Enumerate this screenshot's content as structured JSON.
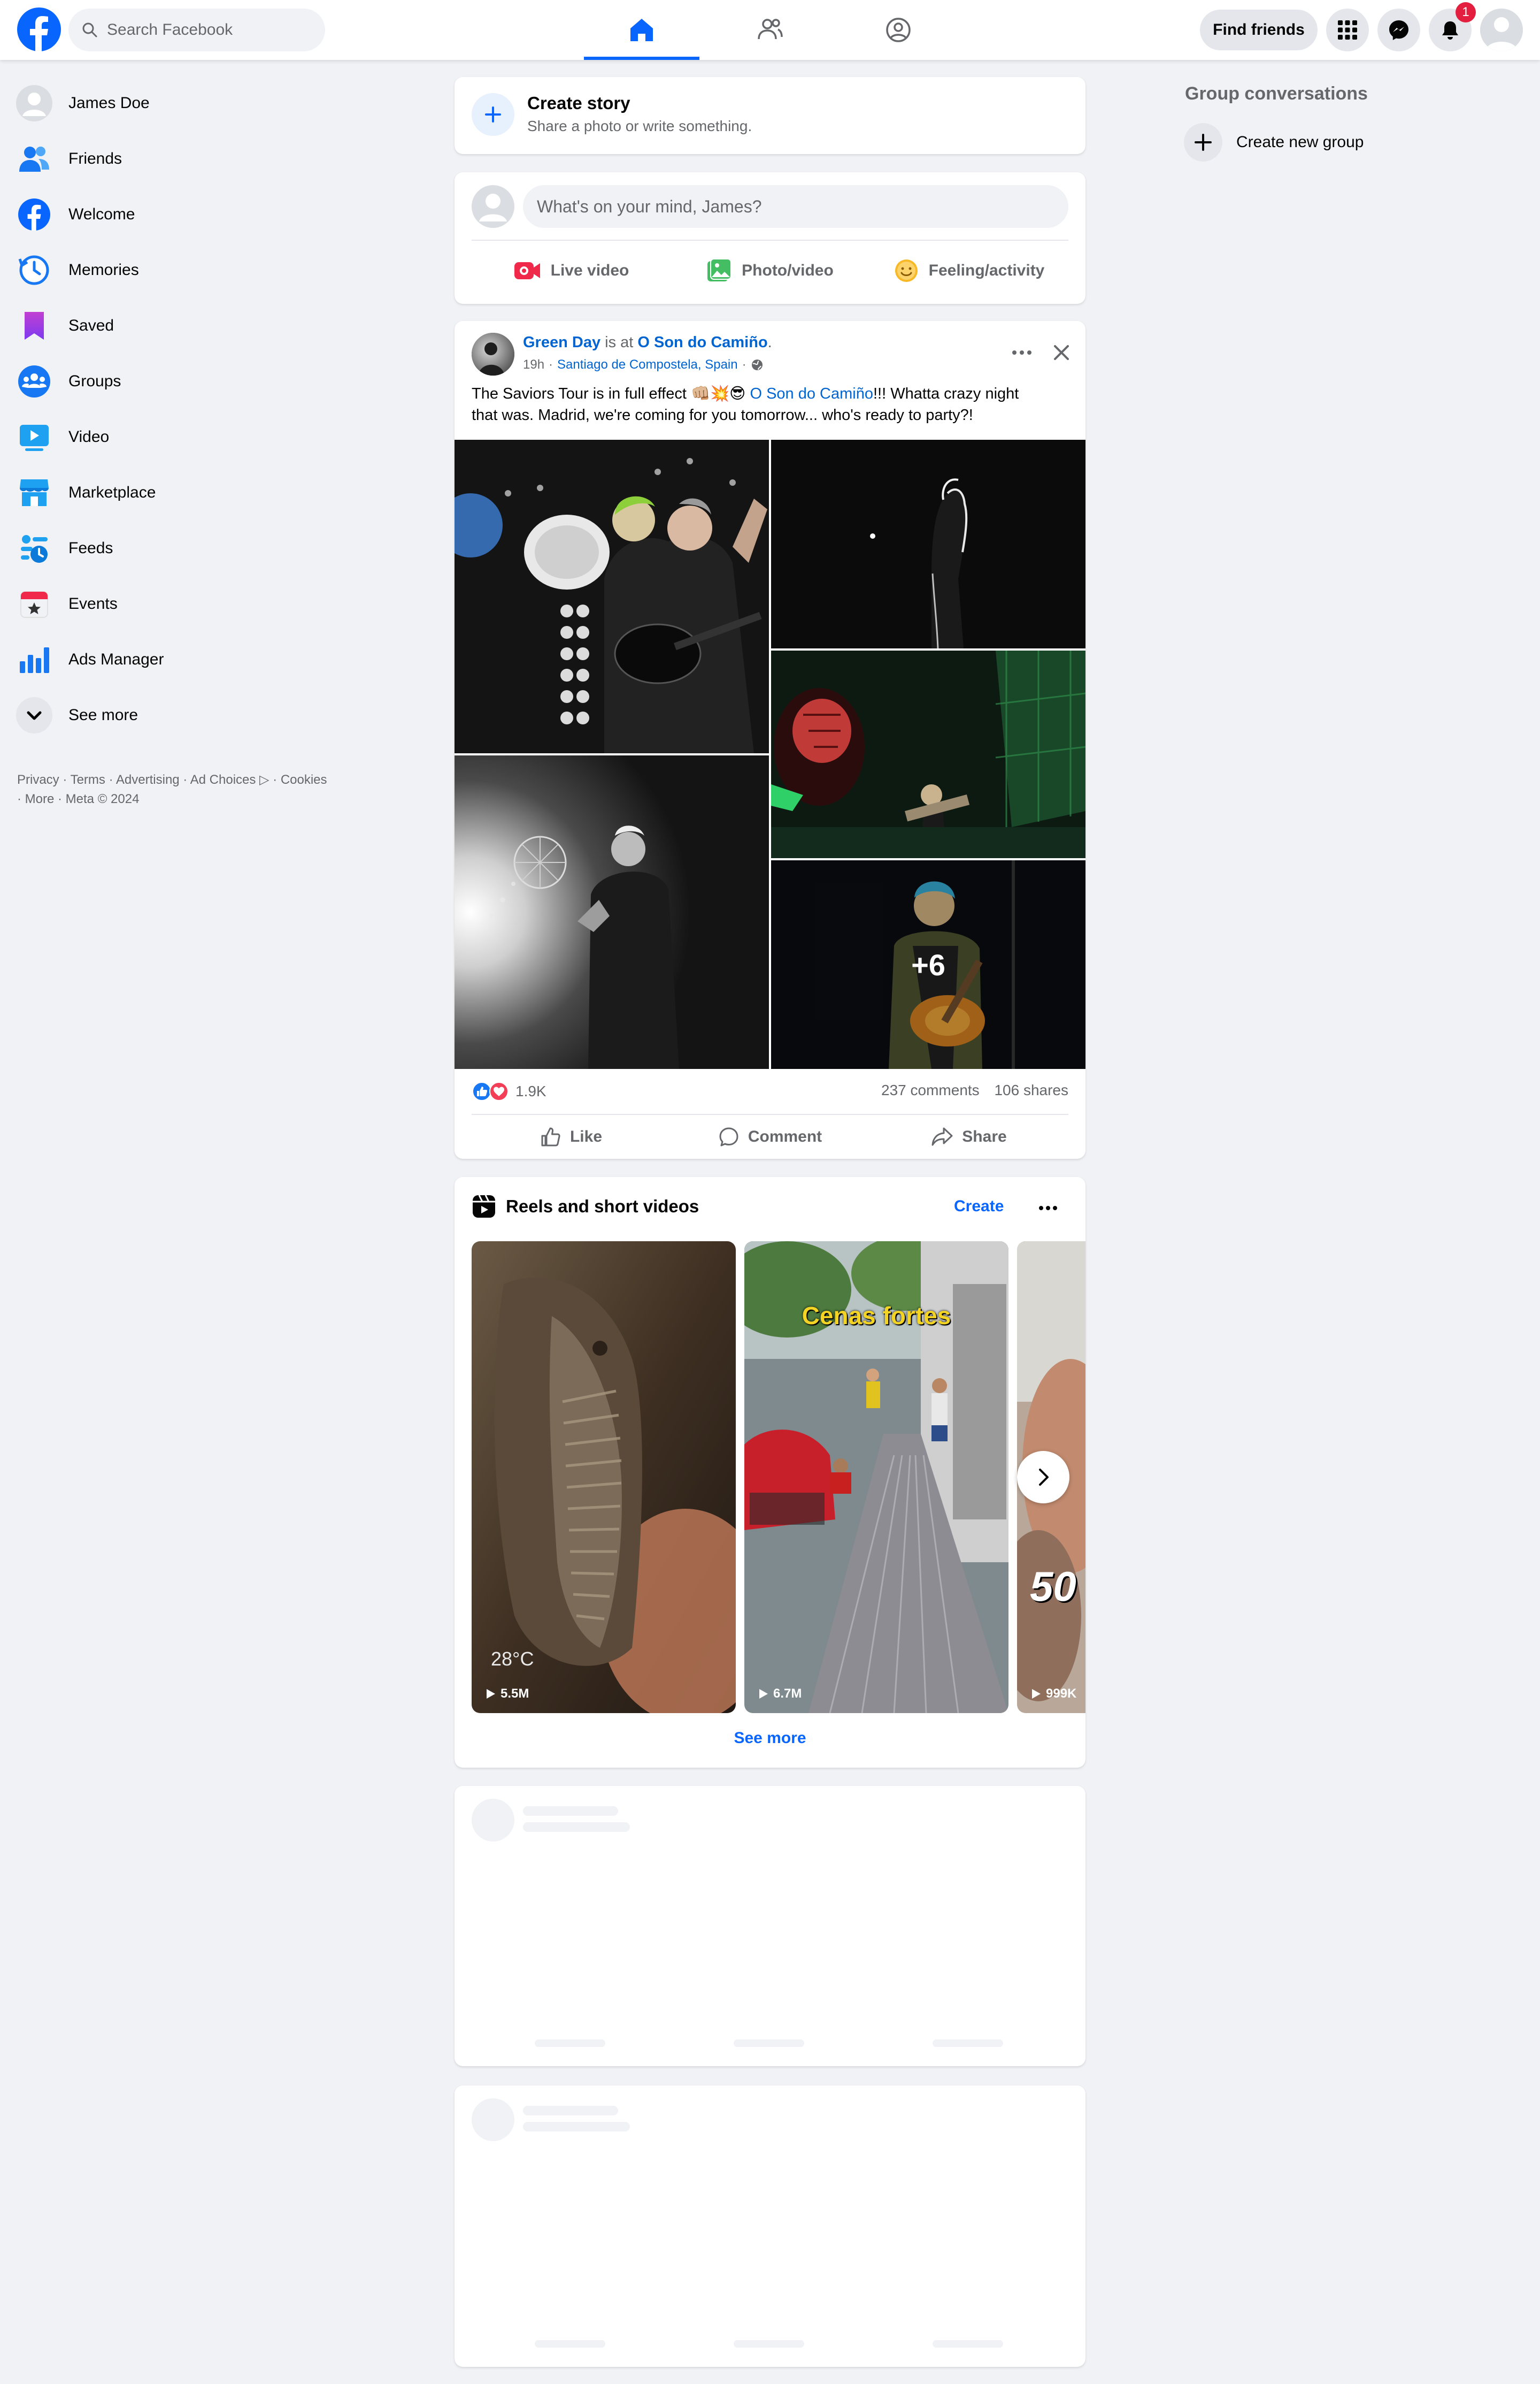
{
  "header": {
    "search_placeholder": "Search Facebook",
    "find_friends_label": "Find friends",
    "notifications_count": "1",
    "accent_color": "#0866ff"
  },
  "sidebar": {
    "items": [
      {
        "label": "James Doe",
        "icon": "profile-avatar"
      },
      {
        "label": "Friends",
        "icon": "friends-icon"
      },
      {
        "label": "Welcome",
        "icon": "facebook-icon"
      },
      {
        "label": "Memories",
        "icon": "memories-clock-icon"
      },
      {
        "label": "Saved",
        "icon": "bookmark-icon"
      },
      {
        "label": "Groups",
        "icon": "groups-icon"
      },
      {
        "label": "Video",
        "icon": "video-play-icon"
      },
      {
        "label": "Marketplace",
        "icon": "marketplace-shop-icon"
      },
      {
        "label": "Feeds",
        "icon": "feeds-icon"
      },
      {
        "label": "Events",
        "icon": "calendar-star-icon"
      },
      {
        "label": "Ads Manager",
        "icon": "bar-chart-icon"
      },
      {
        "label": "See more",
        "icon": "chevron-down-icon"
      }
    ],
    "footer_line1": "Privacy · Terms · Advertising · Ad Choices ▷ · Cookies",
    "footer_line2": "· More · Meta © 2024"
  },
  "create_story": {
    "title": "Create story",
    "subtitle": "Share a photo or write something."
  },
  "composer": {
    "placeholder": "What's on your mind, James?",
    "live_video_label": "Live video",
    "photo_video_label": "Photo/video",
    "feeling_label": "Feeling/activity"
  },
  "post": {
    "author": "Green Day",
    "is_at": "is at",
    "place": "O Son do Camiño",
    "period": ".",
    "time": "19h",
    "location": "Santiago de Compostela, Spain",
    "text_before": "The Saviors Tour is in full effect 👊🏼💥😎",
    "text_mention": "O Son do Camiño",
    "text_after_line1": "!!! Whatta crazy night",
    "text_line2": "that was. Madrid, we're coming for you tomorrow... who's ready to party?!",
    "more_photos": "+6",
    "reactions_count": "1.9K",
    "comments": "237 comments",
    "shares": "106 shares",
    "like_label": "Like",
    "comment_label": "Comment",
    "share_label": "Share"
  },
  "reels": {
    "title": "Reels and short videos",
    "create_label": "Create",
    "see_more_label": "See more",
    "items": [
      {
        "views": "5.5M",
        "overlay": "28°C"
      },
      {
        "views": "6.7M",
        "overlay": "Cenas fortes"
      },
      {
        "views": "999K",
        "overlay": "50"
      }
    ]
  },
  "right_sidebar": {
    "heading": "Group conversations",
    "create_group_label": "Create new group"
  }
}
